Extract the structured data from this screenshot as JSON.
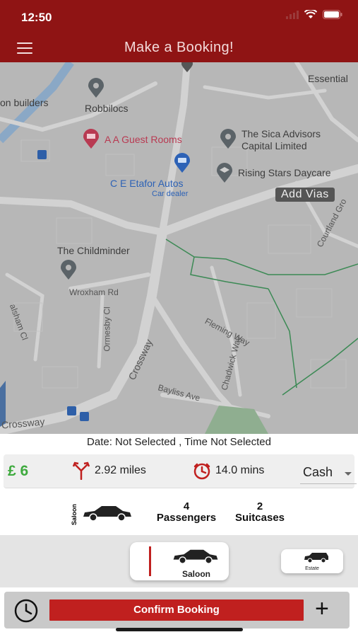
{
  "status_bar": {
    "time": "12:50"
  },
  "header": {
    "title": "Make a Booking!",
    "menu_icon": "hamburger-icon"
  },
  "map": {
    "labels": {
      "robbilocs": "Robbilocs",
      "builders": "on builders",
      "essential": "Essential",
      "guest_rooms": "A A Guest Rooms",
      "sica": "The Sica Advisors",
      "sica2": "Capital Limited",
      "rising_stars": "Rising Stars Daycare",
      "etafor": "C E Etafor Autos",
      "car_dealer": "Car dealer",
      "childminder": "The Childminder",
      "wroxham": "Wroxham Rd",
      "ormesby": "Ormesby Cl",
      "crossway_diag": "Crossway",
      "crossway_bottom": "Crossway",
      "fleming": "Fleming Way",
      "chadwick": "Chadwick Way",
      "bayliss": "Bayliss Ave",
      "countland": "Courtland Gro",
      "walsham": "alsham Cl"
    },
    "add_vias": "Add Vias"
  },
  "booking": {
    "date_line": "Date: Not Selected , Time  Not Selected",
    "price": "£ 6",
    "distance": "2.92 miles",
    "duration": "14.0 mins",
    "payment": "Cash"
  },
  "vehicle_info": {
    "type_vertical": "Saloon",
    "passengers_count": "4",
    "passengers_label": "Passengers",
    "suitcases_count": "2",
    "suitcases_label": "Suitcases"
  },
  "vehicle_options": [
    {
      "label": "Saloon",
      "selected": true
    },
    {
      "label": "Estate",
      "selected": false
    }
  ],
  "actions": {
    "confirm": "Confirm Booking",
    "plus": "+"
  },
  "colors": {
    "brand_red": "#8f1414",
    "button_red": "#c0201f",
    "price_green": "#3eaa3e"
  }
}
